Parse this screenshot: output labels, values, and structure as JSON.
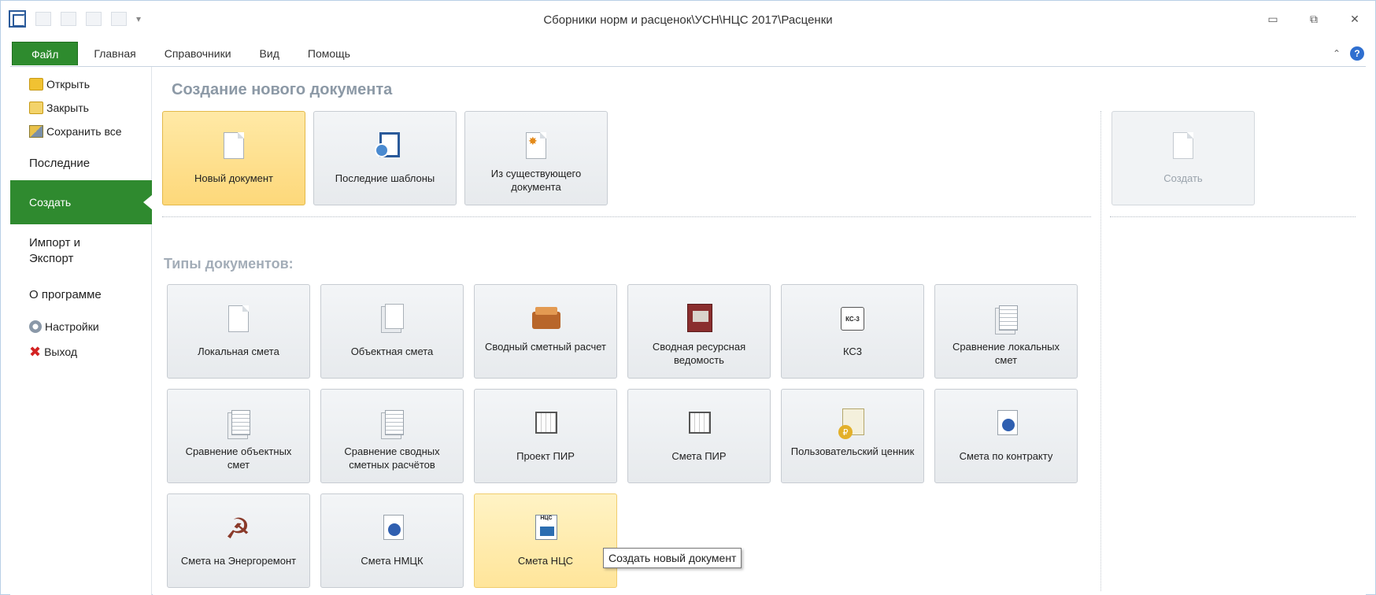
{
  "window": {
    "title": "Сборники норм и расценок\\УСН\\НЦС 2017\\Расценки"
  },
  "ribbon": {
    "tabs": [
      "Файл",
      "Главная",
      "Справочники",
      "Вид",
      "Помощь"
    ]
  },
  "backstage": {
    "commands": {
      "open": "Открыть",
      "close": "Закрыть",
      "save_all": "Сохранить все",
      "settings": "Настройки",
      "exit": "Выход"
    },
    "nav": {
      "recent": "Последние",
      "create": "Создать",
      "import_export": "Импорт и Экспорт",
      "about": "О программе"
    }
  },
  "create": {
    "section_title": "Создание нового документа",
    "new_tiles": [
      {
        "label": "Новый документ",
        "icon": "blank-document-icon"
      },
      {
        "label": "Последние шаблоны",
        "icon": "template-icon"
      },
      {
        "label": "Из существующего документа",
        "icon": "existing-document-icon"
      }
    ],
    "create_button": "Создать",
    "types_title": "Типы документов:",
    "types": [
      {
        "label": "Локальная смета",
        "icon": "blank-document-icon"
      },
      {
        "label": "Объектная смета",
        "icon": "document-stack-icon"
      },
      {
        "label": "Сводный сметный расчет",
        "icon": "box-icon"
      },
      {
        "label": "Сводная ресурсная ведомость",
        "icon": "ledger-icon"
      },
      {
        "label": "КС3",
        "icon": "ks3-icon"
      },
      {
        "label": "Сравнение локальных смет",
        "icon": "compare-documents-icon"
      },
      {
        "label": "Сравнение объектных смет",
        "icon": "compare-documents-icon"
      },
      {
        "label": "Сравнение сводных сметных расчётов",
        "icon": "compare-documents-icon"
      },
      {
        "label": "Проект ПИР",
        "icon": "blueprint-icon"
      },
      {
        "label": "Смета ПИР",
        "icon": "blueprint-icon"
      },
      {
        "label": "Пользовательский ценник",
        "icon": "price-list-icon"
      },
      {
        "label": "Смета по контракту",
        "icon": "emblem-document-icon"
      },
      {
        "label": "Смета на Энергоремонт",
        "icon": "hammer-sickle-icon"
      },
      {
        "label": "Смета НМЦК",
        "icon": "emblem-document-icon"
      },
      {
        "label": "Смета НЦС",
        "icon": "ncs-document-icon"
      }
    ],
    "ks3_badge": "КС-3",
    "ncs_badge": "НЦС"
  },
  "tooltip": "Создать новый документ"
}
